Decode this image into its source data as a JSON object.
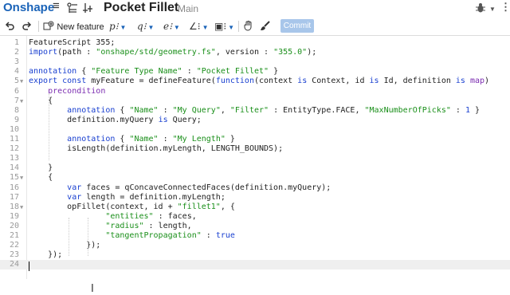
{
  "titlebar": {
    "logo": "Onshape",
    "menu_icon": "≡",
    "doc_title": "Pocket Fillet",
    "branch": "Main"
  },
  "toolbar": {
    "new_feature_label": "New feature",
    "commit_label": "Commit"
  },
  "editor": {
    "lines": [
      {
        "n": "1",
        "fold": "",
        "segs": [
          [
            "pl",
            "FeatureScript 355;"
          ]
        ]
      },
      {
        "n": "2",
        "fold": "",
        "segs": [
          [
            "kw",
            "import"
          ],
          [
            "pl",
            "(path : "
          ],
          [
            "str",
            "\"onshape/std/geometry.fs\""
          ],
          [
            "pl",
            ", version : "
          ],
          [
            "str",
            "\"355.0\""
          ],
          [
            "pl",
            ");"
          ]
        ]
      },
      {
        "n": "3",
        "fold": "",
        "segs": []
      },
      {
        "n": "4",
        "fold": "",
        "segs": [
          [
            "kw",
            "annotation"
          ],
          [
            "pl",
            " { "
          ],
          [
            "str",
            "\"Feature Type Name\""
          ],
          [
            "pl",
            " : "
          ],
          [
            "str",
            "\"Pocket Fillet\""
          ],
          [
            "pl",
            " }"
          ]
        ]
      },
      {
        "n": "5",
        "fold": "▼",
        "segs": [
          [
            "kw",
            "export const"
          ],
          [
            "pl",
            " myFeature = defineFeature("
          ],
          [
            "kw",
            "function"
          ],
          [
            "pl",
            "(context "
          ],
          [
            "kw",
            "is"
          ],
          [
            "pl",
            " Context, id "
          ],
          [
            "kw",
            "is"
          ],
          [
            "pl",
            " Id, definition "
          ],
          [
            "kw",
            "is"
          ],
          [
            "pl",
            " "
          ],
          [
            "ty",
            "map"
          ],
          [
            "pl",
            ")"
          ]
        ]
      },
      {
        "n": "6",
        "fold": "",
        "segs": [
          [
            "pl",
            "    "
          ],
          [
            "ty",
            "precondition"
          ]
        ]
      },
      {
        "n": "7",
        "fold": "▼",
        "segs": [
          [
            "pl",
            "    {"
          ]
        ]
      },
      {
        "n": "8",
        "fold": "",
        "segs": [
          [
            "pl",
            "        "
          ],
          [
            "kw",
            "annotation"
          ],
          [
            "pl",
            " { "
          ],
          [
            "str",
            "\"Name\""
          ],
          [
            "pl",
            " : "
          ],
          [
            "str",
            "\"My Query\""
          ],
          [
            "pl",
            ", "
          ],
          [
            "str",
            "\"Filter\""
          ],
          [
            "pl",
            " : EntityType.FACE, "
          ],
          [
            "str",
            "\"MaxNumberOfPicks\""
          ],
          [
            "pl",
            " : "
          ],
          [
            "kw",
            "1"
          ],
          [
            "pl",
            " }"
          ]
        ]
      },
      {
        "n": "9",
        "fold": "",
        "segs": [
          [
            "pl",
            "        definition.myQuery "
          ],
          [
            "kw",
            "is"
          ],
          [
            "pl",
            " Query;"
          ]
        ]
      },
      {
        "n": "10",
        "fold": "",
        "segs": []
      },
      {
        "n": "11",
        "fold": "",
        "segs": [
          [
            "pl",
            "        "
          ],
          [
            "kw",
            "annotation"
          ],
          [
            "pl",
            " { "
          ],
          [
            "str",
            "\"Name\""
          ],
          [
            "pl",
            " : "
          ],
          [
            "str",
            "\"My Length\""
          ],
          [
            "pl",
            " }"
          ]
        ]
      },
      {
        "n": "12",
        "fold": "",
        "segs": [
          [
            "pl",
            "        isLength(definition.myLength, LENGTH_BOUNDS);"
          ]
        ]
      },
      {
        "n": "13",
        "fold": "",
        "segs": []
      },
      {
        "n": "14",
        "fold": "",
        "segs": [
          [
            "pl",
            "    }"
          ]
        ]
      },
      {
        "n": "15",
        "fold": "▼",
        "segs": [
          [
            "pl",
            "    {"
          ]
        ]
      },
      {
        "n": "16",
        "fold": "",
        "segs": [
          [
            "pl",
            "        "
          ],
          [
            "kw",
            "var"
          ],
          [
            "pl",
            " faces = qConcaveConnectedFaces(definition.myQuery);"
          ]
        ]
      },
      {
        "n": "17",
        "fold": "",
        "segs": [
          [
            "pl",
            "        "
          ],
          [
            "kw",
            "var"
          ],
          [
            "pl",
            " length = definition.myLength;"
          ]
        ]
      },
      {
        "n": "18",
        "fold": "▼",
        "segs": [
          [
            "pl",
            "        opFillet(context, id + "
          ],
          [
            "str",
            "\"fillet1\""
          ],
          [
            "pl",
            ", {"
          ]
        ]
      },
      {
        "n": "19",
        "fold": "",
        "segs": [
          [
            "pl",
            "                "
          ],
          [
            "str",
            "\"entities\""
          ],
          [
            "pl",
            " : faces,"
          ]
        ]
      },
      {
        "n": "20",
        "fold": "",
        "segs": [
          [
            "pl",
            "                "
          ],
          [
            "str",
            "\"radius\""
          ],
          [
            "pl",
            " : length,"
          ]
        ]
      },
      {
        "n": "21",
        "fold": "",
        "segs": [
          [
            "pl",
            "                "
          ],
          [
            "str",
            "\"tangentPropagation\""
          ],
          [
            "pl",
            " : "
          ],
          [
            "kw",
            "true"
          ]
        ]
      },
      {
        "n": "22",
        "fold": "",
        "segs": [
          [
            "pl",
            "            });"
          ]
        ]
      },
      {
        "n": "23",
        "fold": "",
        "segs": [
          [
            "pl",
            "    });"
          ]
        ]
      },
      {
        "n": "24",
        "fold": "",
        "segs": []
      }
    ],
    "active_line": "24"
  }
}
